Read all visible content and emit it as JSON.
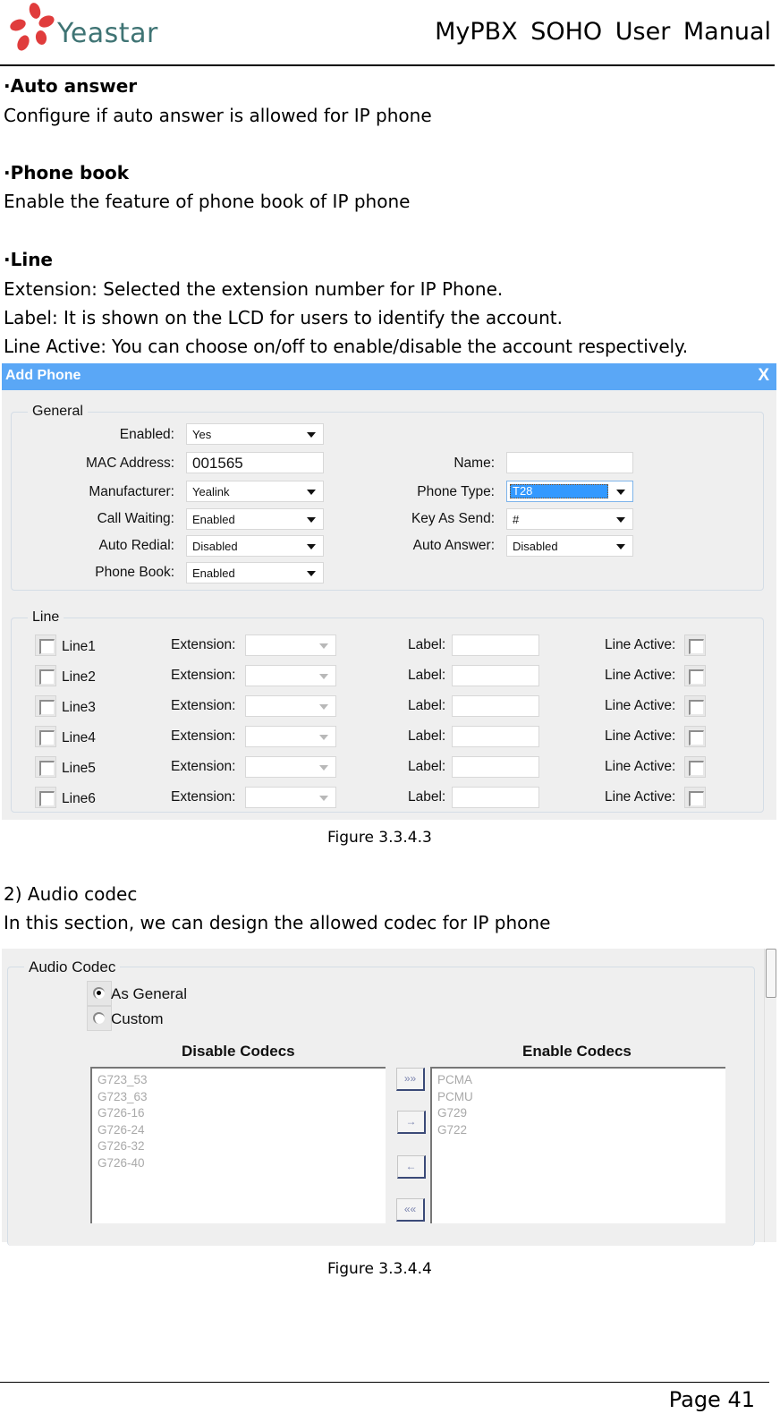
{
  "header": {
    "logo_text": "Yeastar",
    "doc_title": "MyPBX SOHO User Manual"
  },
  "body": {
    "auto_answer_heading": "·Auto answer",
    "auto_answer_text": "Configure if auto answer is allowed for IP phone",
    "phone_book_heading": "·Phone book",
    "phone_book_text": "Enable the feature of phone book of IP phone",
    "line_heading": "·Line",
    "line_text_1": "Extension: Selected the extension number for IP Phone.",
    "line_text_2": "Label: It is shown on the LCD for users to identify the account.",
    "line_text_3": "Line Active: You can choose on/off to enable/disable the account respectively.",
    "figure_1_caption": "Figure 3.3.4.3",
    "audio_codec_heading": "2)  Audio codec",
    "audio_codec_text": "In this section, we can design the allowed codec for IP phone",
    "figure_2_caption": "Figure 3.3.4.4"
  },
  "dialog": {
    "title": "Add Phone",
    "close_label": "X",
    "accent_color": "#5aa7f6",
    "general": {
      "legend": "General",
      "enabled": {
        "label": "Enabled:",
        "value": "Yes"
      },
      "mac_address": {
        "label": "MAC Address:",
        "value": "001565"
      },
      "manufacturer": {
        "label": "Manufacturer:",
        "value": "Yealink"
      },
      "call_waiting": {
        "label": "Call Waiting:",
        "value": "Enabled"
      },
      "auto_redial": {
        "label": "Auto Redial:",
        "value": "Disabled"
      },
      "phone_book": {
        "label": "Phone Book:",
        "value": "Enabled"
      },
      "name": {
        "label": "Name:",
        "value": ""
      },
      "phone_type": {
        "label": "Phone Type:",
        "value": "T28"
      },
      "key_as_send": {
        "label": "Key As Send:",
        "value": "#"
      },
      "auto_answer": {
        "label": "Auto Answer:",
        "value": "Disabled"
      }
    },
    "line": {
      "legend": "Line",
      "extension_label": "Extension:",
      "label_label": "Label:",
      "line_active_label": "Line Active:",
      "rows": [
        {
          "name": "Line1",
          "checked": false,
          "extension": "",
          "label": "",
          "active": false
        },
        {
          "name": "Line2",
          "checked": false,
          "extension": "",
          "label": "",
          "active": false
        },
        {
          "name": "Line3",
          "checked": false,
          "extension": "",
          "label": "",
          "active": false
        },
        {
          "name": "Line4",
          "checked": false,
          "extension": "",
          "label": "",
          "active": false
        },
        {
          "name": "Line5",
          "checked": false,
          "extension": "",
          "label": "",
          "active": false
        },
        {
          "name": "Line6",
          "checked": false,
          "extension": "",
          "label": "",
          "active": false
        }
      ]
    }
  },
  "audio_codec": {
    "legend": "Audio Codec",
    "options": [
      {
        "label": "As General",
        "selected": true
      },
      {
        "label": "Custom",
        "selected": false
      }
    ],
    "disable_heading": "Disable Codecs",
    "enable_heading": "Enable Codecs",
    "disabled_codecs": [
      "G723_53",
      "G723_63",
      "G726-16",
      "G726-24",
      "G726-32",
      "G726-40"
    ],
    "enabled_codecs": [
      "PCMA",
      "PCMU",
      "G729",
      "G722"
    ],
    "buttons": {
      "move_all_right": "»»",
      "move_right": "→",
      "move_left": "←",
      "move_all_left": "««"
    }
  },
  "footer": {
    "page_label": "Page 41"
  }
}
